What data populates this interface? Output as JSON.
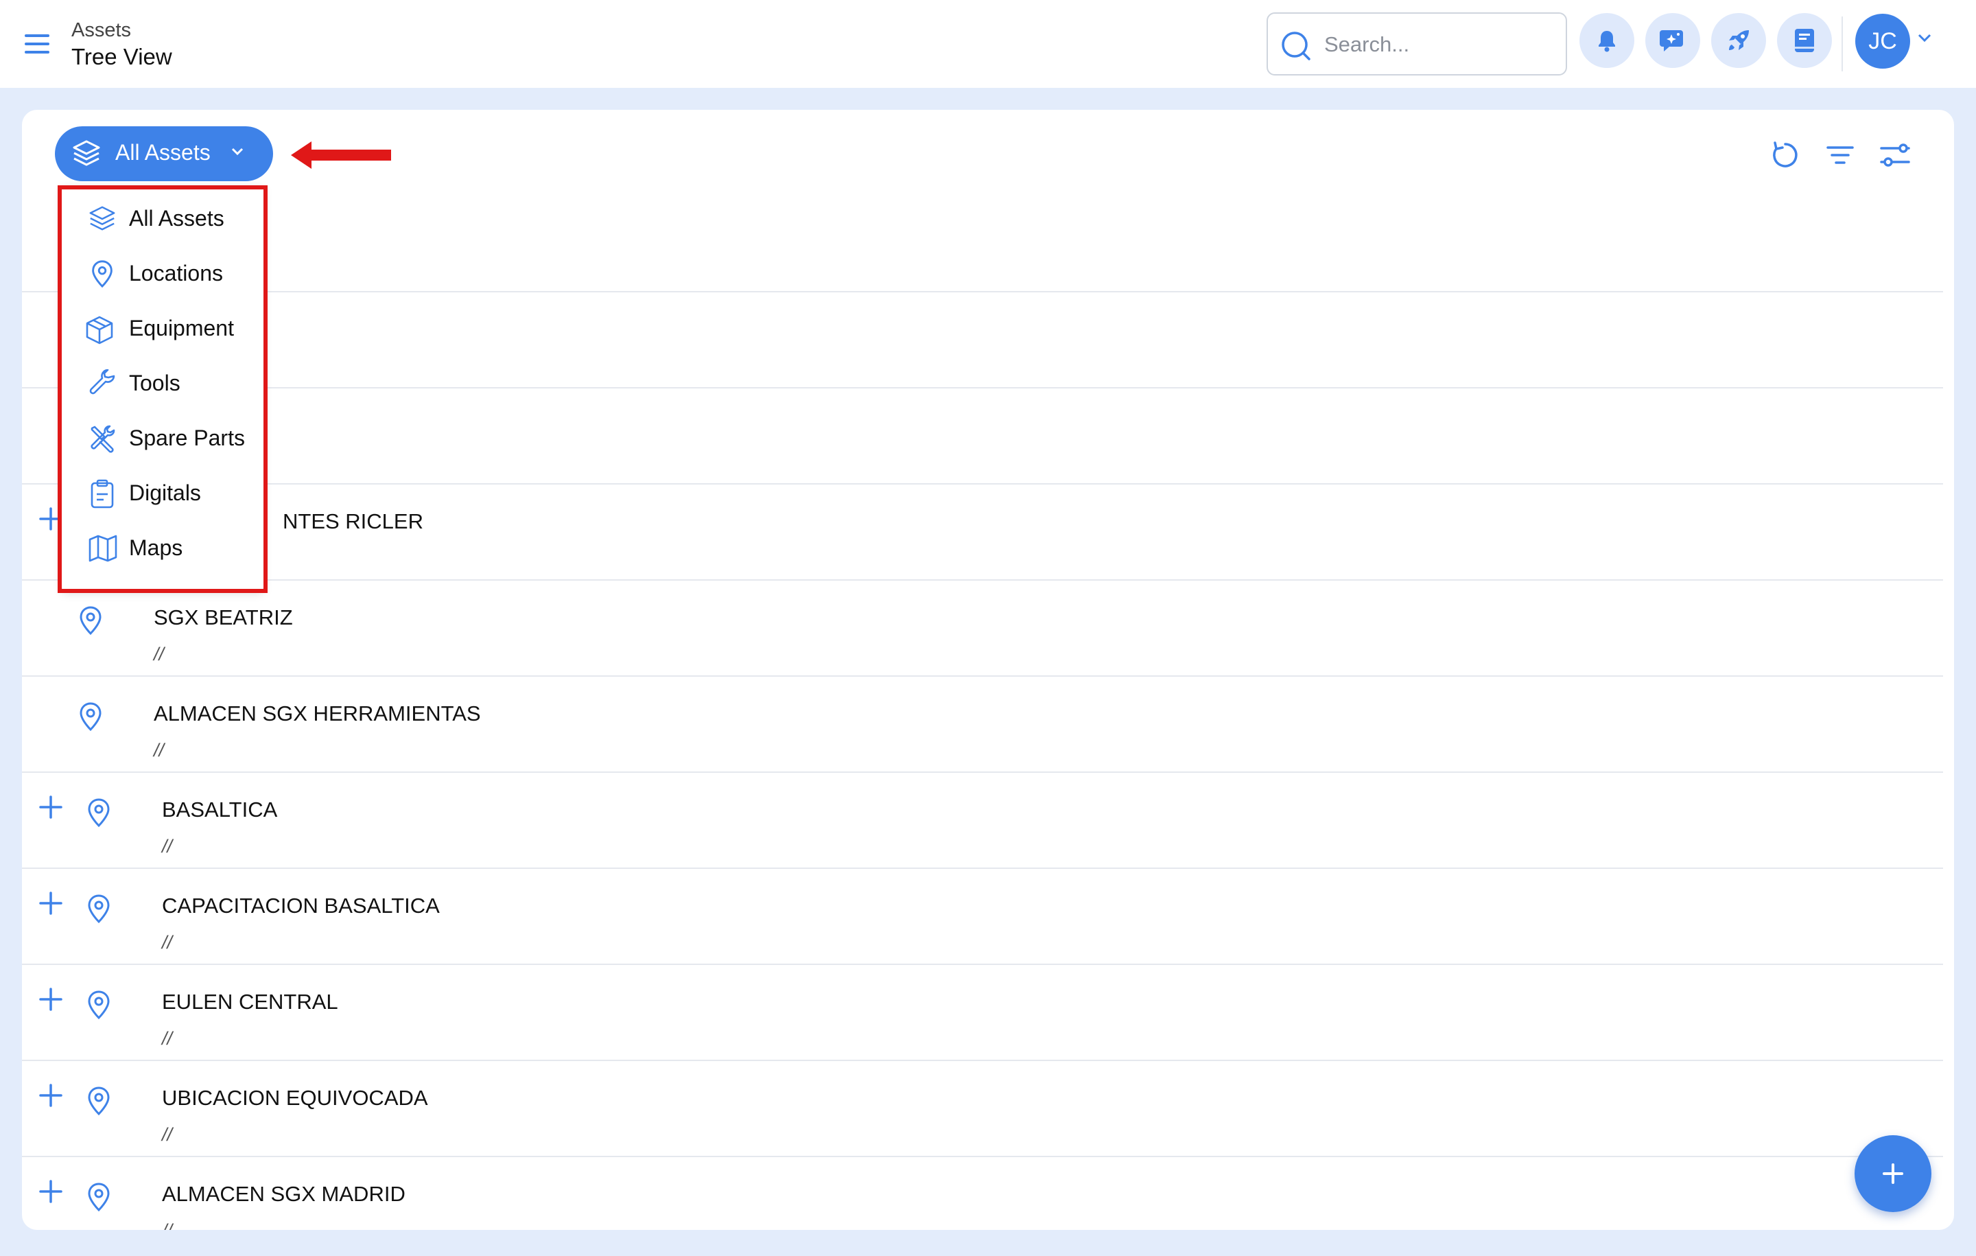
{
  "header": {
    "breadcrumb_parent": "Assets",
    "title": "Tree View",
    "search_placeholder": "Search...",
    "avatar_initials": "JC",
    "icons": [
      "menu-icon",
      "search-icon",
      "bell-icon",
      "chat-sparkle-icon",
      "rocket-icon",
      "book-icon",
      "chevron-down-icon"
    ]
  },
  "filter": {
    "selected_label": "All Assets",
    "options": [
      {
        "label": "All Assets",
        "icon": "layers-icon"
      },
      {
        "label": "Locations",
        "icon": "location-pin-icon"
      },
      {
        "label": "Equipment",
        "icon": "box-icon"
      },
      {
        "label": "Tools",
        "icon": "wrench-icon"
      },
      {
        "label": "Spare Parts",
        "icon": "tools-cross-icon"
      },
      {
        "label": "Digitals",
        "icon": "clipboard-icon"
      },
      {
        "label": "Maps",
        "icon": "map-icon"
      }
    ]
  },
  "toolbar": {
    "icons": [
      "refresh-icon",
      "filter-lines-icon",
      "sliders-icon"
    ]
  },
  "tree": {
    "rows": [
      {
        "name": "",
        "path": ""
      },
      {
        "name": "",
        "path": ""
      },
      {
        "name": "NTES RICLER",
        "path": ""
      },
      {
        "name": "SGX BEATRIZ",
        "path": "//"
      },
      {
        "name": "ALMACEN SGX HERRAMIENTAS",
        "path": "//"
      },
      {
        "name": "BASALTICA",
        "path": "//"
      },
      {
        "name": "CAPACITACION BASALTICA",
        "path": "//"
      },
      {
        "name": "EULEN CENTRAL",
        "path": "//"
      },
      {
        "name": "UBICACION EQUIVOCADA",
        "path": "//"
      },
      {
        "name": "ALMACEN SGX MADRID",
        "path": "//"
      }
    ]
  },
  "colors": {
    "accent": "#3e82e8",
    "background": "#e3ecfb",
    "highlight": "#e01818"
  }
}
